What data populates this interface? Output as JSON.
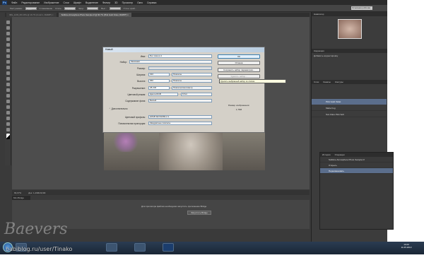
{
  "app": {
    "logo": "Ps",
    "menus": [
      "Файл",
      "Редактирование",
      "Изображение",
      "Слои",
      "Шрифт",
      "Выделение",
      "Фильтр",
      "3D",
      "Просмотр",
      "Окно",
      "Справка"
    ]
  },
  "options": {
    "feather_label": "Растушевка:",
    "feather_value": "0 пикс",
    "smooth_label": "Сглаживание",
    "style_label": "Стиль:",
    "style_value": "Обычный",
    "width_label": "Шир.:",
    "height_label": "Выс.:",
    "refine_label": "Уточн. край...",
    "workspace": "Основная рабочая"
  },
  "tabs": [
    {
      "label": "IMG_1233_RO.JPG @ 16.7% (Слой 1, RGB/8*) ×"
    },
    {
      "label": "Sublime Atmosphere Photo Sample.tif @ 66.7% (Pink Gold Violet, RGB/8*) ×"
    }
  ],
  "status": {
    "zoom": "66,67%",
    "doc": "Док: 1,29М/29,9М"
  },
  "minibridge": {
    "tab": "Mini Bridge",
    "text": "Для просмотра файлов необходимо запустить приложение Bridge",
    "button": "Запустить Bridge"
  },
  "dialog": {
    "title": "Новый",
    "name_label": "Имя:",
    "name_value": "Без имени-1",
    "preset_label": "Набор:",
    "preset_value": "Заказная",
    "size_label": "Размер:",
    "width_label": "Ширина:",
    "width_value": "640",
    "width_unit": "Пикселы",
    "height_label": "Высота:",
    "height_value": "960",
    "height_unit": "Пикселы",
    "res_label": "Разрешение:",
    "res_value": "28,346",
    "res_unit": "Пикселы/сантиметр",
    "mode_label": "Цветовой режим:",
    "mode_value": "Цвета RGB",
    "bits_value": "8 бит",
    "bg_label": "Содержимое фона:",
    "bg_value": "Белый",
    "advanced_label": "Дополнительно",
    "profile_label": "Цветовой профиль:",
    "profile_value": "sRGB IEC61966-2.1",
    "aspect_label": "Попиксельная пропорция:",
    "aspect_value": "Квадратные пикселы",
    "ok": "ОК",
    "cancel": "Отмена",
    "save_preset": "Сохранить набор параметров...",
    "delete_preset": "Удалить набор...",
    "image_size_label": "Размер изображения:",
    "image_size_value": "1,76М"
  },
  "tooltip": "Удалить выбранный набор из списка.",
  "panels": {
    "navigator": "Навигатор",
    "correction_title": "Коррекция",
    "correction_sub": "Добавить корректировку",
    "layers_tabs": [
      "Слои",
      "Каналы",
      "Контуры"
    ],
    "layers": [
      {
        "name": "Pink Gold Violet"
      },
      {
        "name": "Matte Fog"
      },
      {
        "name": "Sun Flare Pink Soft"
      }
    ],
    "history_tabs": [
      "История",
      "Операции"
    ],
    "history": [
      {
        "label": "Sublime Atmosphere Photo Sample.tif"
      },
      {
        "label": "Открыть"
      },
      {
        "label": "Переименовать"
      }
    ]
  },
  "taskbar": {
    "time": "10:20",
    "date": "11.05.2013"
  },
  "watermarks": {
    "brand": "Baevers",
    "url": "babiblog.ru/user/Tinako"
  }
}
